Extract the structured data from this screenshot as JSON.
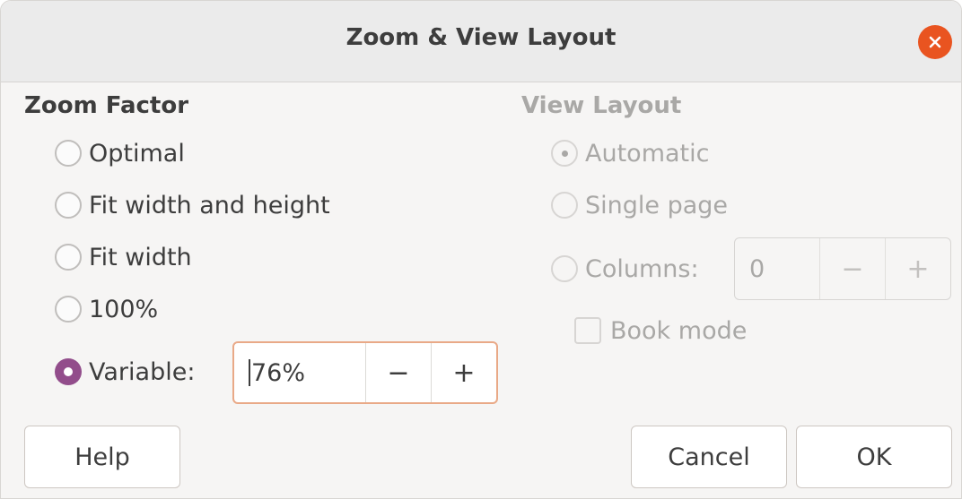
{
  "window": {
    "title": "Zoom & View Layout"
  },
  "zoom_factor": {
    "heading": "Zoom Factor",
    "options": [
      {
        "label": "Optimal",
        "checked": false
      },
      {
        "label": "Fit width and height",
        "checked": false
      },
      {
        "label": "Fit width",
        "checked": false
      },
      {
        "label": "100%",
        "checked": false
      },
      {
        "label": "Variable:",
        "checked": true
      }
    ],
    "variable_value": "76%",
    "minus_label": "−",
    "plus_label": "+"
  },
  "view_layout": {
    "heading": "View Layout",
    "enabled": false,
    "options": [
      {
        "label": "Automatic",
        "checked": true
      },
      {
        "label": "Single page",
        "checked": false
      },
      {
        "label": "Columns:",
        "checked": false
      }
    ],
    "columns_value": "0",
    "minus_label": "−",
    "plus_label": "+",
    "book_mode_label": "Book mode",
    "book_mode_checked": false
  },
  "buttons": {
    "help": "Help",
    "cancel": "Cancel",
    "ok": "OK"
  },
  "colors": {
    "accent": "#924d8b",
    "close": "#e95420",
    "focus": "#e9a987"
  }
}
